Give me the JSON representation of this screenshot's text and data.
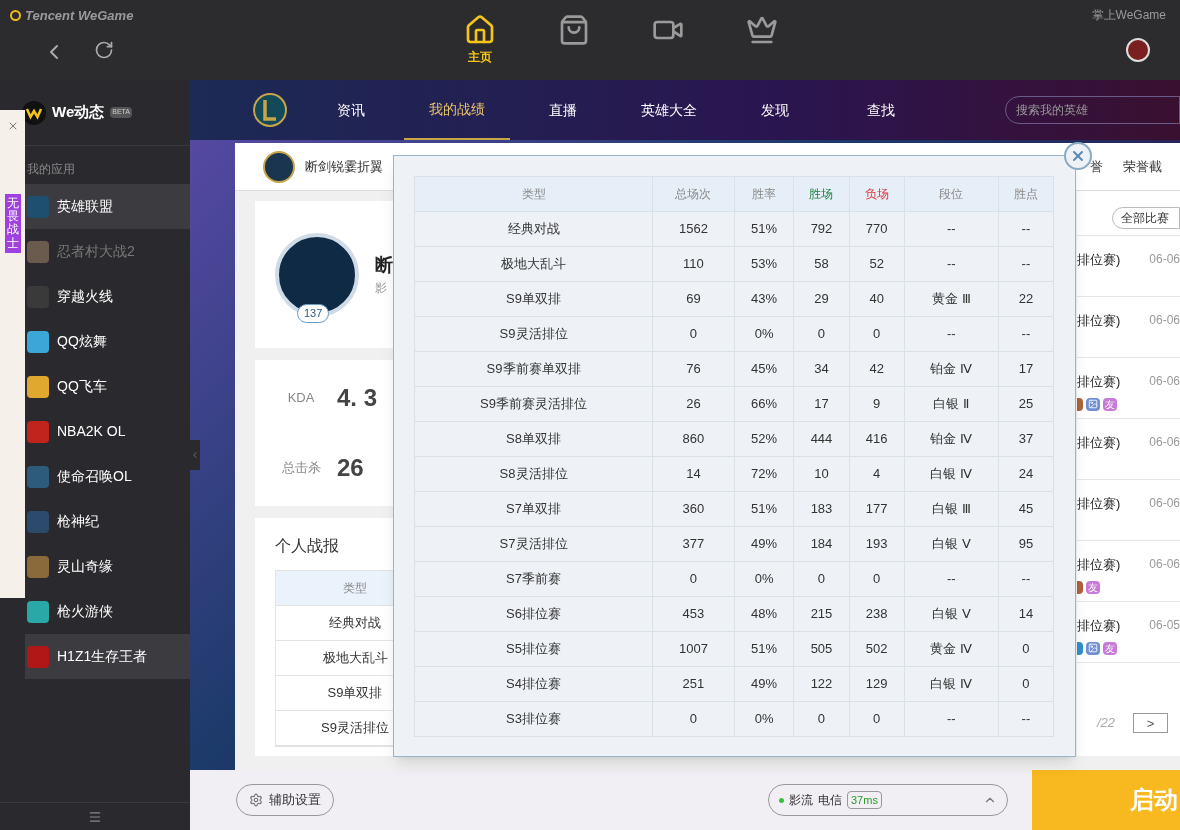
{
  "titlebar": {
    "brand": "Tencent WeGame",
    "mobile_link": "掌上WeGame"
  },
  "top_nav": [
    {
      "kind": "home",
      "label": "主页",
      "selected": true
    },
    {
      "kind": "store",
      "selected": false
    },
    {
      "kind": "video",
      "selected": false
    },
    {
      "kind": "crown",
      "selected": false
    }
  ],
  "floating_panel": {
    "ribbon": "无畏战士"
  },
  "sidebar": {
    "feed": {
      "title": "We动态",
      "badge": "BETA"
    },
    "section": "我的应用",
    "items": [
      {
        "label": "英雄联盟",
        "color": "#1f4f6f",
        "selected": true,
        "dimmed": false
      },
      {
        "label": "忍者村大战2",
        "color": "#6b5a4e",
        "selected": false,
        "dimmed": true
      },
      {
        "label": "穿越火线",
        "color": "#3a3a3a",
        "selected": false,
        "dimmed": false
      },
      {
        "label": "QQ炫舞",
        "color": "#3aa7d8",
        "selected": false,
        "dimmed": false
      },
      {
        "label": "QQ飞车",
        "color": "#e0a82e",
        "selected": false,
        "dimmed": false
      },
      {
        "label": "NBA2K OL",
        "color": "#c0241c",
        "selected": false,
        "dimmed": false
      },
      {
        "label": "使命召唤OL",
        "color": "#2d5b7c",
        "selected": false,
        "dimmed": false
      },
      {
        "label": "枪神纪",
        "color": "#2c4a6b",
        "selected": false,
        "dimmed": false
      },
      {
        "label": "灵山奇缘",
        "color": "#8a6a3a",
        "selected": false,
        "dimmed": false
      },
      {
        "label": "枪火游侠",
        "color": "#2aa8a8",
        "selected": false,
        "dimmed": false
      },
      {
        "label": "H1Z1生存王者",
        "color": "#b01818",
        "selected": true,
        "dimmed": false
      }
    ]
  },
  "game_nav": {
    "tabs": [
      {
        "label": "资讯",
        "selected": false
      },
      {
        "label": "我的战绩",
        "selected": true
      },
      {
        "label": "直播",
        "selected": false
      },
      {
        "label": "英雄大全",
        "selected": false
      },
      {
        "label": "发现",
        "selected": false
      },
      {
        "label": "查找",
        "selected": false
      }
    ],
    "search": {
      "placeholder": "搜索我的英雄"
    }
  },
  "profile_header": {
    "name": "断剑锐霎折翼",
    "tabs": [
      "誉",
      "荣誉截"
    ]
  },
  "profile": {
    "name": "断",
    "subtitle": "影",
    "level": "137"
  },
  "stats": [
    {
      "label": "KDA",
      "value": "4. 3"
    },
    {
      "label": "总击杀",
      "value": "26"
    }
  ],
  "report": {
    "title": "个人战报",
    "column": "类型",
    "rows": [
      "经典对战",
      "极地大乱斗",
      "S9单双排",
      "S9灵活排位"
    ]
  },
  "match_list": {
    "filter": "全部比赛",
    "rows": [
      {
        "mode": "排位赛)",
        "date": "06-06",
        "tags": []
      },
      {
        "mode": "排位赛)",
        "date": "06-06",
        "tags": []
      },
      {
        "mode": "排位赛)",
        "date": "06-06",
        "tags": [
          {
            "kind": "partial",
            "color": "#b0623a"
          },
          {
            "kind": "image",
            "color": "#6f8fd0"
          },
          {
            "kind": "friend",
            "label": "友",
            "color": "#c77ad8"
          }
        ]
      },
      {
        "mode": "排位赛)",
        "date": "06-06",
        "tags": []
      },
      {
        "mode": "排位赛)",
        "date": "06-06",
        "tags": []
      },
      {
        "mode": "排位赛)",
        "date": "06-06",
        "tags": [
          {
            "kind": "partial",
            "color": "#b0623a"
          },
          {
            "kind": "friend",
            "label": "友",
            "color": "#c77ad8"
          }
        ]
      },
      {
        "mode": "排位赛)",
        "date": "06-05",
        "tags": [
          {
            "kind": "partial",
            "color": "#2f8fd0"
          },
          {
            "kind": "image",
            "color": "#6f8fd0"
          },
          {
            "kind": "friend",
            "label": "友",
            "color": "#c77ad8"
          }
        ]
      }
    ],
    "pagination": {
      "total": "/22",
      "next": ">"
    }
  },
  "stats_popup": {
    "columns": [
      {
        "label": "类型",
        "color": "#888888"
      },
      {
        "label": "总场次",
        "color": "#888888"
      },
      {
        "label": "胜率",
        "color": "#888888"
      },
      {
        "label": "胜场",
        "color": "#1a7f3c"
      },
      {
        "label": "负场",
        "color": "#d9343a"
      },
      {
        "label": "段位",
        "color": "#888888"
      },
      {
        "label": "胜点",
        "color": "#888888"
      }
    ],
    "rows": [
      [
        "经典对战",
        "1562",
        "51%",
        "792",
        "770",
        "--",
        "--"
      ],
      [
        "极地大乱斗",
        "110",
        "53%",
        "58",
        "52",
        "--",
        "--"
      ],
      [
        "S9单双排",
        "69",
        "43%",
        "29",
        "40",
        "黄金 Ⅲ",
        "22"
      ],
      [
        "S9灵活排位",
        "0",
        "0%",
        "0",
        "0",
        "--",
        "--"
      ],
      [
        "S9季前赛单双排",
        "76",
        "45%",
        "34",
        "42",
        "铂金 Ⅳ",
        "17"
      ],
      [
        "S9季前赛灵活排位",
        "26",
        "66%",
        "17",
        "9",
        "白银 Ⅱ",
        "25"
      ],
      [
        "S8单双排",
        "860",
        "52%",
        "444",
        "416",
        "铂金 Ⅳ",
        "37"
      ],
      [
        "S8灵活排位",
        "14",
        "72%",
        "10",
        "4",
        "白银 Ⅳ",
        "24"
      ],
      [
        "S7单双排",
        "360",
        "51%",
        "183",
        "177",
        "白银 Ⅲ",
        "45"
      ],
      [
        "S7灵活排位",
        "377",
        "49%",
        "184",
        "193",
        "白银 Ⅴ",
        "95"
      ],
      [
        "S7季前赛",
        "0",
        "0%",
        "0",
        "0",
        "--",
        "--"
      ],
      [
        "S6排位赛",
        "453",
        "48%",
        "215",
        "238",
        "白银 Ⅴ",
        "14"
      ],
      [
        "S5排位赛",
        "1007",
        "51%",
        "505",
        "502",
        "黄金 Ⅳ",
        "0"
      ],
      [
        "S4排位赛",
        "251",
        "49%",
        "122",
        "129",
        "白银 Ⅳ",
        "0"
      ],
      [
        "S3排位赛",
        "0",
        "0%",
        "0",
        "0",
        "--",
        "--"
      ]
    ]
  },
  "bottom_bar": {
    "settings": "辅助设置",
    "server": {
      "name": "影流",
      "isp": "电信",
      "ping": "37ms",
      "online": true
    },
    "launch": "启动"
  }
}
